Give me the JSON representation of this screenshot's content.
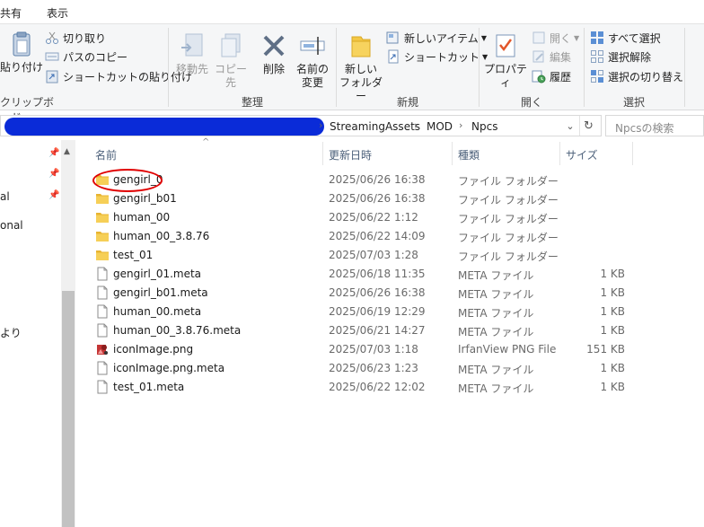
{
  "menu": {
    "tabs": [
      "共有",
      "表示"
    ]
  },
  "ribbon": {
    "clipboard": {
      "paste_label": "貼り付け",
      "cut_label": "切り取り",
      "copy_path_label": "パスのコピー",
      "paste_shortcut_label": "ショートカットの貼り付け",
      "group_label": "クリップボード"
    },
    "organize": {
      "move_label": "移動先",
      "copy_label": "コピー先",
      "delete_label": "削除",
      "rename_label": "名前の\n変更",
      "group_label": "整理"
    },
    "new": {
      "new_folder_label": "新しい\nフォルダー",
      "new_item_label": "新しいアイテム",
      "shortcut_label": "ショートカット",
      "group_label": "新規"
    },
    "open": {
      "properties_label": "プロパティ",
      "open_label": "開く",
      "edit_label": "編集",
      "history_label": "履歴",
      "group_label": "開く"
    },
    "select": {
      "select_all_label": "すべて選択",
      "select_none_label": "選択解除",
      "invert_label": "選択の切り替え",
      "group_label": "選択"
    }
  },
  "address": {
    "crumbs": [
      "StreamingAssets",
      "MOD",
      "Npcs"
    ]
  },
  "search": {
    "placeholder": "Npcsの検索"
  },
  "nav": {
    "items": [
      "al",
      "onal",
      "より"
    ]
  },
  "columns": {
    "name": "名前",
    "date": "更新日時",
    "type": "種類",
    "size": "サイズ"
  },
  "files": [
    {
      "name": "gengirl_0",
      "date": "2025/06/26 16:38",
      "type": "ファイル フォルダー",
      "size": "",
      "icon": "folder-icon"
    },
    {
      "name": "gengirl_b01",
      "date": "2025/06/26 16:38",
      "type": "ファイル フォルダー",
      "size": "",
      "icon": "folder-icon"
    },
    {
      "name": "human_00",
      "date": "2025/06/22 1:12",
      "type": "ファイル フォルダー",
      "size": "",
      "icon": "folder-icon"
    },
    {
      "name": "human_00_3.8.76",
      "date": "2025/06/22 14:09",
      "type": "ファイル フォルダー",
      "size": "",
      "icon": "folder-icon"
    },
    {
      "name": "test_01",
      "date": "2025/07/03 1:28",
      "type": "ファイル フォルダー",
      "size": "",
      "icon": "folder-icon"
    },
    {
      "name": "gengirl_01.meta",
      "date": "2025/06/18 11:35",
      "type": "META ファイル",
      "size": "1 KB",
      "icon": "file-icon"
    },
    {
      "name": "gengirl_b01.meta",
      "date": "2025/06/26 16:38",
      "type": "META ファイル",
      "size": "1 KB",
      "icon": "file-icon"
    },
    {
      "name": "human_00.meta",
      "date": "2025/06/19 12:29",
      "type": "META ファイル",
      "size": "1 KB",
      "icon": "file-icon"
    },
    {
      "name": "human_00_3.8.76.meta",
      "date": "2025/06/21 14:27",
      "type": "META ファイル",
      "size": "1 KB",
      "icon": "file-icon"
    },
    {
      "name": "iconImage.png",
      "date": "2025/07/03 1:18",
      "type": "IrfanView PNG File",
      "size": "151 KB",
      "icon": "png-image-icon"
    },
    {
      "name": "iconImage.png.meta",
      "date": "2025/06/23 1:23",
      "type": "META ファイル",
      "size": "1 KB",
      "icon": "file-icon"
    },
    {
      "name": "test_01.meta",
      "date": "2025/06/22 12:02",
      "type": "META ファイル",
      "size": "1 KB",
      "icon": "file-icon"
    }
  ],
  "colors": {
    "redaction": "#0a2bd8",
    "annotation_circle": "#e00000",
    "folder": "#f3c744"
  }
}
